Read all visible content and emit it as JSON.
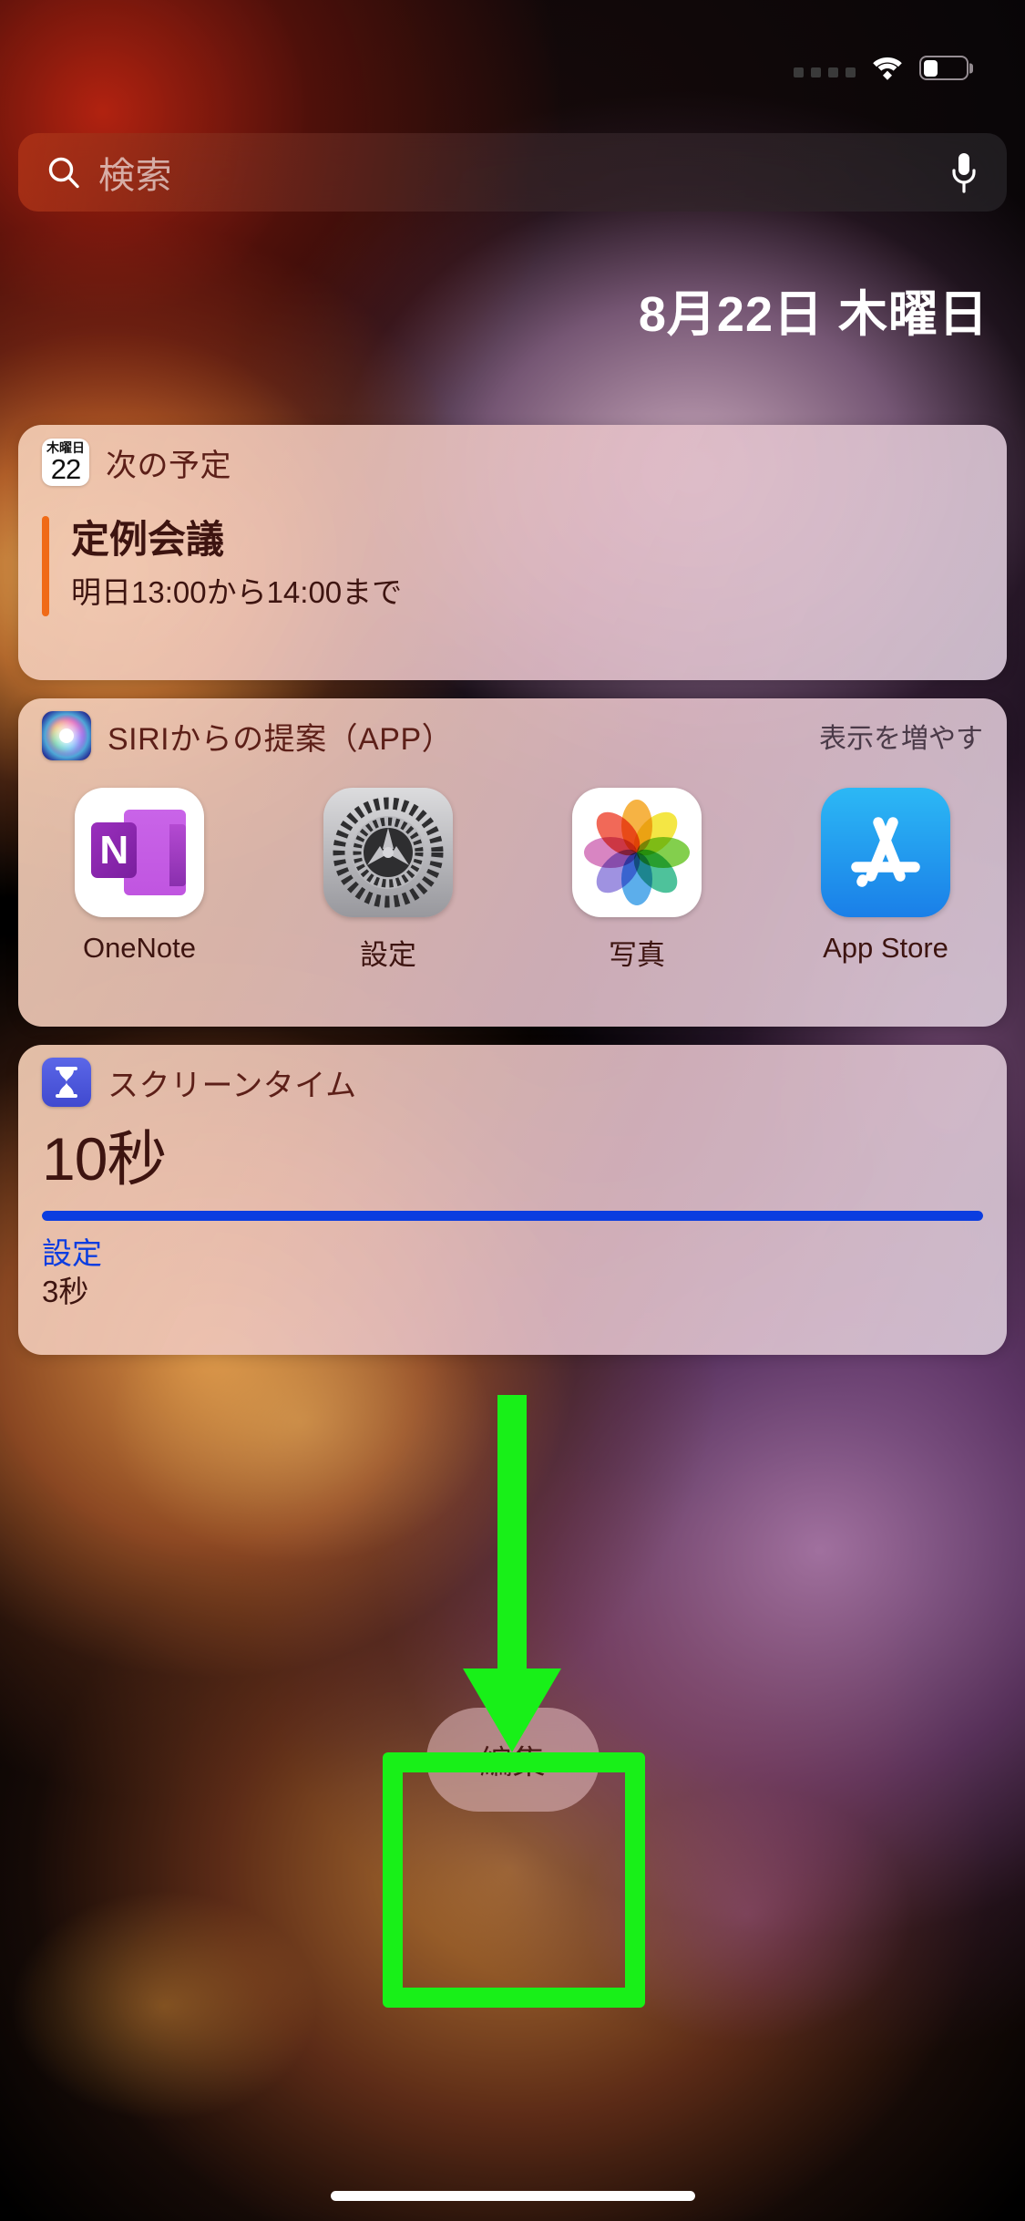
{
  "statusbar": {
    "signal_dots": 4,
    "wifi_icon": "wifi-icon",
    "battery_icon": "battery-icon",
    "battery_level_pct": 35
  },
  "search": {
    "placeholder": "検索",
    "icon": "search-icon",
    "mic_icon": "microphone-icon"
  },
  "date_header": "8月22日 木曜日",
  "widgets": {
    "calendar": {
      "title": "次の予定",
      "icon": "calendar-icon",
      "icon_dow": "木曜日",
      "icon_day": "22",
      "event": {
        "title": "定例会議",
        "time": "明日13:00から14:00まで",
        "bar_color": "#f06a16"
      }
    },
    "siri": {
      "title": "SIRIからの提案（APP）",
      "icon": "siri-icon",
      "more_label": "表示を増やす",
      "apps": [
        {
          "label": "OneNote",
          "icon": "onenote-icon",
          "letter": "N"
        },
        {
          "label": "設定",
          "icon": "settings-icon"
        },
        {
          "label": "写真",
          "icon": "photos-icon"
        },
        {
          "label": "App Store",
          "icon": "app-store-icon"
        }
      ]
    },
    "screentime": {
      "title": "スクリーンタイム",
      "icon": "hourglass-icon",
      "value": "10秒",
      "progress_pct": 100,
      "progress_color": "#0b3de0",
      "link_label": "設定",
      "link_value": "3秒"
    }
  },
  "edit_button": {
    "label": "編集"
  },
  "annotation": {
    "highlight_color": "#18f018",
    "arrow_icon": "down-arrow-annotation",
    "box_icon": "highlight-box-annotation"
  }
}
